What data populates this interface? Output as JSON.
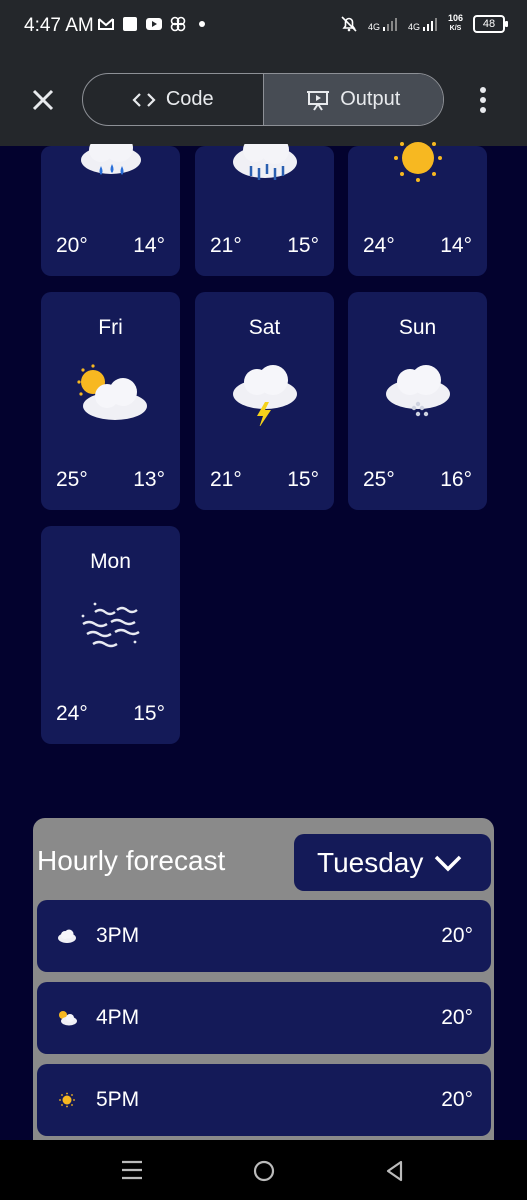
{
  "status_bar": {
    "time": "4:47 AM",
    "net1": "4G",
    "net2": "4G",
    "speed_value": "106",
    "speed_unit": "K/S",
    "battery": "48"
  },
  "toolbar": {
    "code_label": "Code",
    "output_label": "Output"
  },
  "daily": [
    {
      "day": "",
      "high": "20°",
      "low": "14°",
      "icon": "rain-cloud-icon"
    },
    {
      "day": "",
      "high": "21°",
      "low": "15°",
      "icon": "heavy-rain-icon"
    },
    {
      "day": "",
      "high": "24°",
      "low": "14°",
      "icon": "sun-icon"
    },
    {
      "day": "Fri",
      "high": "25°",
      "low": "13°",
      "icon": "partly-cloudy-icon"
    },
    {
      "day": "Sat",
      "high": "21°",
      "low": "15°",
      "icon": "thunderstorm-icon"
    },
    {
      "day": "Sun",
      "high": "25°",
      "low": "16°",
      "icon": "snow-cloud-icon"
    },
    {
      "day": "Mon",
      "high": "24°",
      "low": "15°",
      "icon": "wind-icon"
    }
  ],
  "hourly": {
    "title": "Hourly forecast",
    "selected_day": "Tuesday",
    "rows": [
      {
        "time": "3PM",
        "temp": "20°",
        "icon": "cloud-icon"
      },
      {
        "time": "4PM",
        "temp": "20°",
        "icon": "partly-cloudy-icon"
      },
      {
        "time": "5PM",
        "temp": "20°",
        "icon": "sun-icon"
      }
    ]
  },
  "colors": {
    "background": "#03022e",
    "card": "#141a58",
    "panel": "#8a8a8a",
    "toolbar": "#24272b"
  }
}
